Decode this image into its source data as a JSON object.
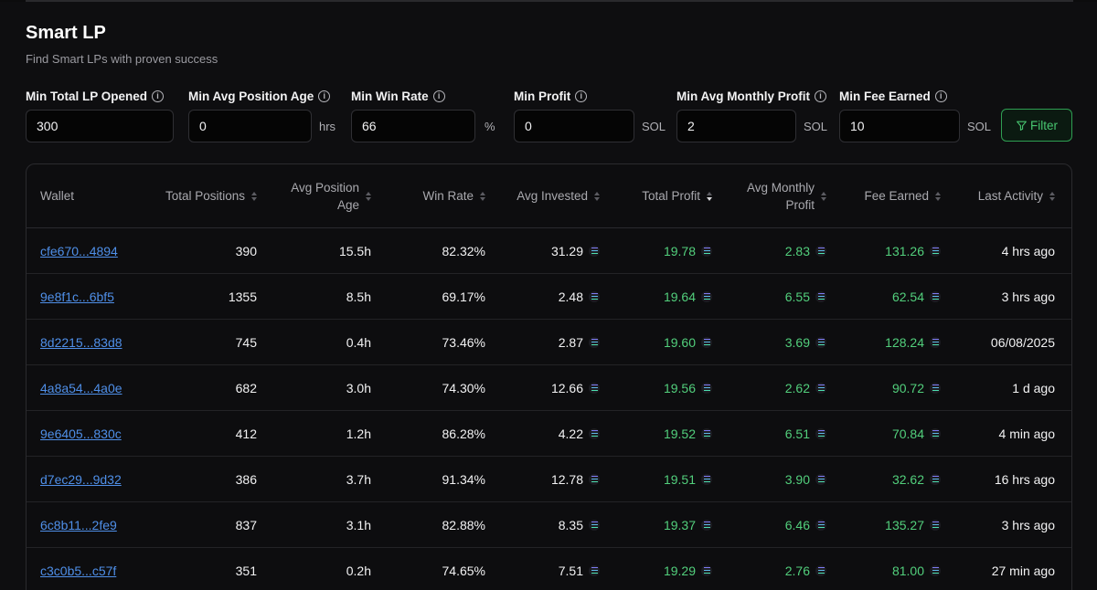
{
  "page": {
    "title": "Smart LP",
    "subtitle": "Find Smart LPs with proven success"
  },
  "filters": [
    {
      "label": "Min Total LP Opened",
      "value": "300",
      "unit": ""
    },
    {
      "label": "Min Avg Position Age",
      "value": "0",
      "unit": "hrs"
    },
    {
      "label": "Min Win Rate",
      "value": "66",
      "unit": "%"
    },
    {
      "label": "Min Profit",
      "value": "0",
      "unit": "SOL"
    },
    {
      "label": "Min Avg Monthly Profit",
      "value": "2",
      "unit": "SOL"
    },
    {
      "label": "Min Fee Earned",
      "value": "10",
      "unit": "SOL"
    }
  ],
  "filter_button": {
    "label": "Filter",
    "color": "#47c56f"
  },
  "table": {
    "columns": {
      "wallet": "Wallet",
      "total_positions": "Total Positions",
      "avg_position_age_1": "Avg Position",
      "avg_position_age_2": "Age",
      "win_rate": "Win Rate",
      "avg_invested": "Avg Invested",
      "total_profit": "Total Profit",
      "avg_monthly_profit_1": "Avg Monthly",
      "avg_monthly_profit_2": "Profit",
      "fee_earned": "Fee Earned",
      "last_activity": "Last Activity"
    },
    "sorted_by": "Total Profit (descending)",
    "currency_icon": "solana-icon",
    "rows": [
      {
        "wallet": "cfe670...4894",
        "total_positions": "390",
        "avg_position_age": "15.5h",
        "win_rate": "82.32%",
        "avg_invested": "31.29",
        "total_profit": "19.78",
        "avg_monthly_profit": "2.83",
        "fee_earned": "131.26",
        "last_activity": "4 hrs ago"
      },
      {
        "wallet": "9e8f1c...6bf5",
        "total_positions": "1355",
        "avg_position_age": "8.5h",
        "win_rate": "69.17%",
        "avg_invested": "2.48",
        "total_profit": "19.64",
        "avg_monthly_profit": "6.55",
        "fee_earned": "62.54",
        "last_activity": "3 hrs ago"
      },
      {
        "wallet": "8d2215...83d8",
        "total_positions": "745",
        "avg_position_age": "0.4h",
        "win_rate": "73.46%",
        "avg_invested": "2.87",
        "total_profit": "19.60",
        "avg_monthly_profit": "3.69",
        "fee_earned": "128.24",
        "last_activity": "06/08/2025"
      },
      {
        "wallet": "4a8a54...4a0e",
        "total_positions": "682",
        "avg_position_age": "3.0h",
        "win_rate": "74.30%",
        "avg_invested": "12.66",
        "total_profit": "19.56",
        "avg_monthly_profit": "2.62",
        "fee_earned": "90.72",
        "last_activity": "1 d ago"
      },
      {
        "wallet": "9e6405...830c",
        "total_positions": "412",
        "avg_position_age": "1.2h",
        "win_rate": "86.28%",
        "avg_invested": "4.22",
        "total_profit": "19.52",
        "avg_monthly_profit": "6.51",
        "fee_earned": "70.84",
        "last_activity": "4 min ago"
      },
      {
        "wallet": "d7ec29...9d32",
        "total_positions": "386",
        "avg_position_age": "3.7h",
        "win_rate": "91.34%",
        "avg_invested": "12.78",
        "total_profit": "19.51",
        "avg_monthly_profit": "3.90",
        "fee_earned": "32.62",
        "last_activity": "16 hrs ago"
      },
      {
        "wallet": "6c8b11...2fe9",
        "total_positions": "837",
        "avg_position_age": "3.1h",
        "win_rate": "82.88%",
        "avg_invested": "8.35",
        "total_profit": "19.37",
        "avg_monthly_profit": "6.46",
        "fee_earned": "135.27",
        "last_activity": "3 hrs ago"
      },
      {
        "wallet": "c3c0b5...c57f",
        "total_positions": "351",
        "avg_position_age": "0.2h",
        "win_rate": "74.65%",
        "avg_invested": "7.51",
        "total_profit": "19.29",
        "avg_monthly_profit": "2.76",
        "fee_earned": "81.00",
        "last_activity": "27 min ago"
      }
    ]
  },
  "colors": {
    "background": "#0c0c0d",
    "link": "#4f8fe8",
    "profit_green": "#52cf7c",
    "filter_border": "#2f9e52"
  }
}
